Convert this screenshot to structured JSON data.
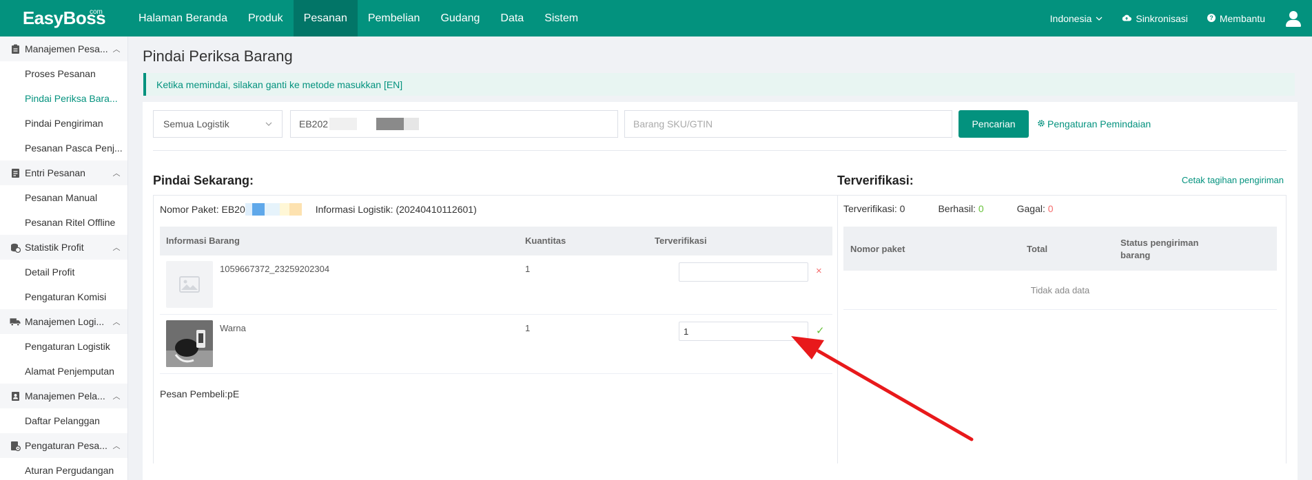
{
  "app": {
    "logo": "EasyBoss",
    "logo_suffix": "com"
  },
  "nav": [
    "Halaman Beranda",
    "Produk",
    "Pesanan",
    "Pembelian",
    "Gudang",
    "Data",
    "Sistem"
  ],
  "top_right": {
    "language": "Indonesia",
    "sync": "Sinkronisasi",
    "help": "Membantu"
  },
  "sidebar": {
    "g1": "Manajemen Pesa...",
    "g1_items": [
      "Proses Pesanan",
      "Pindai Periksa Bara...",
      "Pindai Pengiriman",
      "Pesanan Pasca Penj..."
    ],
    "g2": "Entri Pesanan",
    "g2_items": [
      "Pesanan Manual",
      "Pesanan Ritel Offline"
    ],
    "g3": "Statistik Profit",
    "g3_items": [
      "Detail Profit",
      "Pengaturan Komisi"
    ],
    "g4": "Manajemen Logi...",
    "g4_items": [
      "Pengaturan Logistik",
      "Alamat Penjemputan"
    ],
    "g5": "Manajemen Pela...",
    "g5_items": [
      "Daftar Pelanggan"
    ],
    "g6": "Pengaturan Pesa...",
    "g6_items": [
      "Aturan Pergudangan"
    ]
  },
  "page": {
    "title": "Pindai Periksa Barang",
    "alert": "Ketika memindai, silakan ganti ke metode masukkan [EN]"
  },
  "search": {
    "logistics": "Semua Logistik",
    "order_prefix": "EB202",
    "sku_placeholder": "Barang SKU/GTIN",
    "button": "Pencarian",
    "setting": "Pengaturan Pemindaian"
  },
  "scan": {
    "title": "Pindai Sekarang:",
    "pkg_label": "Nomor Paket: EB20",
    "logistic_info": "Informasi Logistik: (20240410112601)",
    "headers": [
      "Informasi Barang",
      "Kuantitas",
      "Terverifikasi"
    ],
    "rows": [
      {
        "name": "1059667372_23259202304",
        "qty": "1",
        "verified": "",
        "status": "×"
      },
      {
        "name": "Warna",
        "qty": "1",
        "verified": "1",
        "status": "✓"
      }
    ],
    "buyer_msg": "Pesan Pembeli:pE"
  },
  "verified": {
    "title": "Terverifikasi:",
    "print": "Cetak tagihan pengiriman",
    "stat_verified": "Terverifikasi: 0",
    "stat_success_label": "Berhasil:",
    "stat_success": "0",
    "stat_fail_label": "Gagal:",
    "stat_fail": "0",
    "headers": [
      "Nomor paket",
      "Total",
      "Status pengiriman barang"
    ],
    "empty": "Tidak ada data"
  },
  "colors": {
    "brand": "#03927e",
    "success": "#67c23a",
    "danger": "#f56c6c",
    "arrow": "#e8191b"
  }
}
